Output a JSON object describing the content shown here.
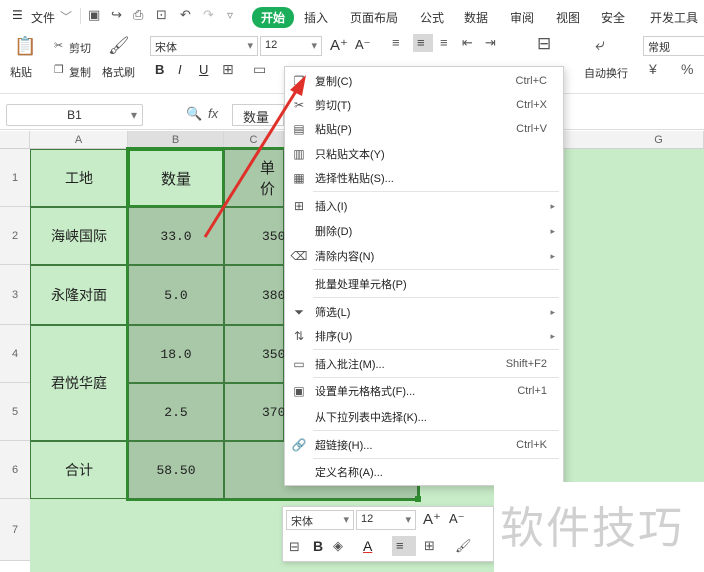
{
  "menubar": {
    "menu_label": "文件",
    "tabs": [
      "开始",
      "插入",
      "页面布局",
      "公式",
      "数据",
      "审阅",
      "视图",
      "安全",
      "开发工具"
    ]
  },
  "ribbon": {
    "paste": "粘贴",
    "cut": "剪切",
    "copy": "复制",
    "format_painter": "格式刷",
    "font_name": "宋体",
    "font_size": "12",
    "number_format": "常规",
    "wrap": "自动换行",
    "bold": "B",
    "italic": "I",
    "underline": "U"
  },
  "formula_bar": {
    "name_box": "B1",
    "fx": "fx",
    "value": "数量"
  },
  "columns": [
    "A",
    "B",
    "C",
    "G"
  ],
  "rows": [
    "1",
    "2",
    "3",
    "4",
    "5",
    "6",
    "7"
  ],
  "table": {
    "header": [
      "工地",
      "数量",
      "单价"
    ],
    "land": [
      "海峡国际",
      "永隆对面",
      "君悦华庭",
      "合计"
    ],
    "qty": [
      "33.0",
      "5.0",
      "18.0",
      "2.5",
      "58.50"
    ],
    "price": [
      "350",
      "380",
      "350",
      "370"
    ]
  },
  "context_menu": {
    "items": [
      {
        "label": "复制(C)",
        "shortcut": "Ctrl+C",
        "icon": "copy-icon"
      },
      {
        "label": "剪切(T)",
        "shortcut": "Ctrl+X",
        "icon": "scissors-icon"
      },
      {
        "label": "粘贴(P)",
        "shortcut": "Ctrl+V",
        "icon": "clipboard-icon"
      },
      {
        "label": "只粘贴文本(Y)",
        "shortcut": "",
        "icon": "paste-text-icon"
      },
      {
        "label": "选择性粘贴(S)...",
        "shortcut": "",
        "icon": "paste-special-icon"
      },
      {
        "label": "插入(I)",
        "shortcut": "",
        "icon": "insert-icon"
      },
      {
        "label": "删除(D)",
        "shortcut": "",
        "icon": ""
      },
      {
        "label": "清除内容(N)",
        "shortcut": "",
        "icon": "eraser-icon"
      },
      {
        "label": "批量处理单元格(P)",
        "shortcut": "",
        "icon": ""
      },
      {
        "label": "筛选(L)",
        "shortcut": "",
        "icon": "filter-icon"
      },
      {
        "label": "排序(U)",
        "shortcut": "",
        "icon": "sort-icon"
      },
      {
        "label": "插入批注(M)...",
        "shortcut": "Shift+F2",
        "icon": "comment-icon"
      },
      {
        "label": "设置单元格格式(F)...",
        "shortcut": "Ctrl+1",
        "icon": "format-cells-icon"
      },
      {
        "label": "从下拉列表中选择(K)...",
        "shortcut": "",
        "icon": ""
      },
      {
        "label": "超链接(H)...",
        "shortcut": "Ctrl+K",
        "icon": "link-icon"
      },
      {
        "label": "定义名称(A)...",
        "shortcut": "",
        "icon": ""
      }
    ]
  },
  "mini_toolbar": {
    "font_name": "宋体",
    "font_size": "12",
    "bold": "B",
    "a_letter": "A"
  },
  "watermark": "软件技巧",
  "colors": {
    "accent": "#1aad5a",
    "cell_green": "#c8ecc8",
    "cell_green_dark": "#a8c8a8",
    "arrow": "#e0302a"
  }
}
